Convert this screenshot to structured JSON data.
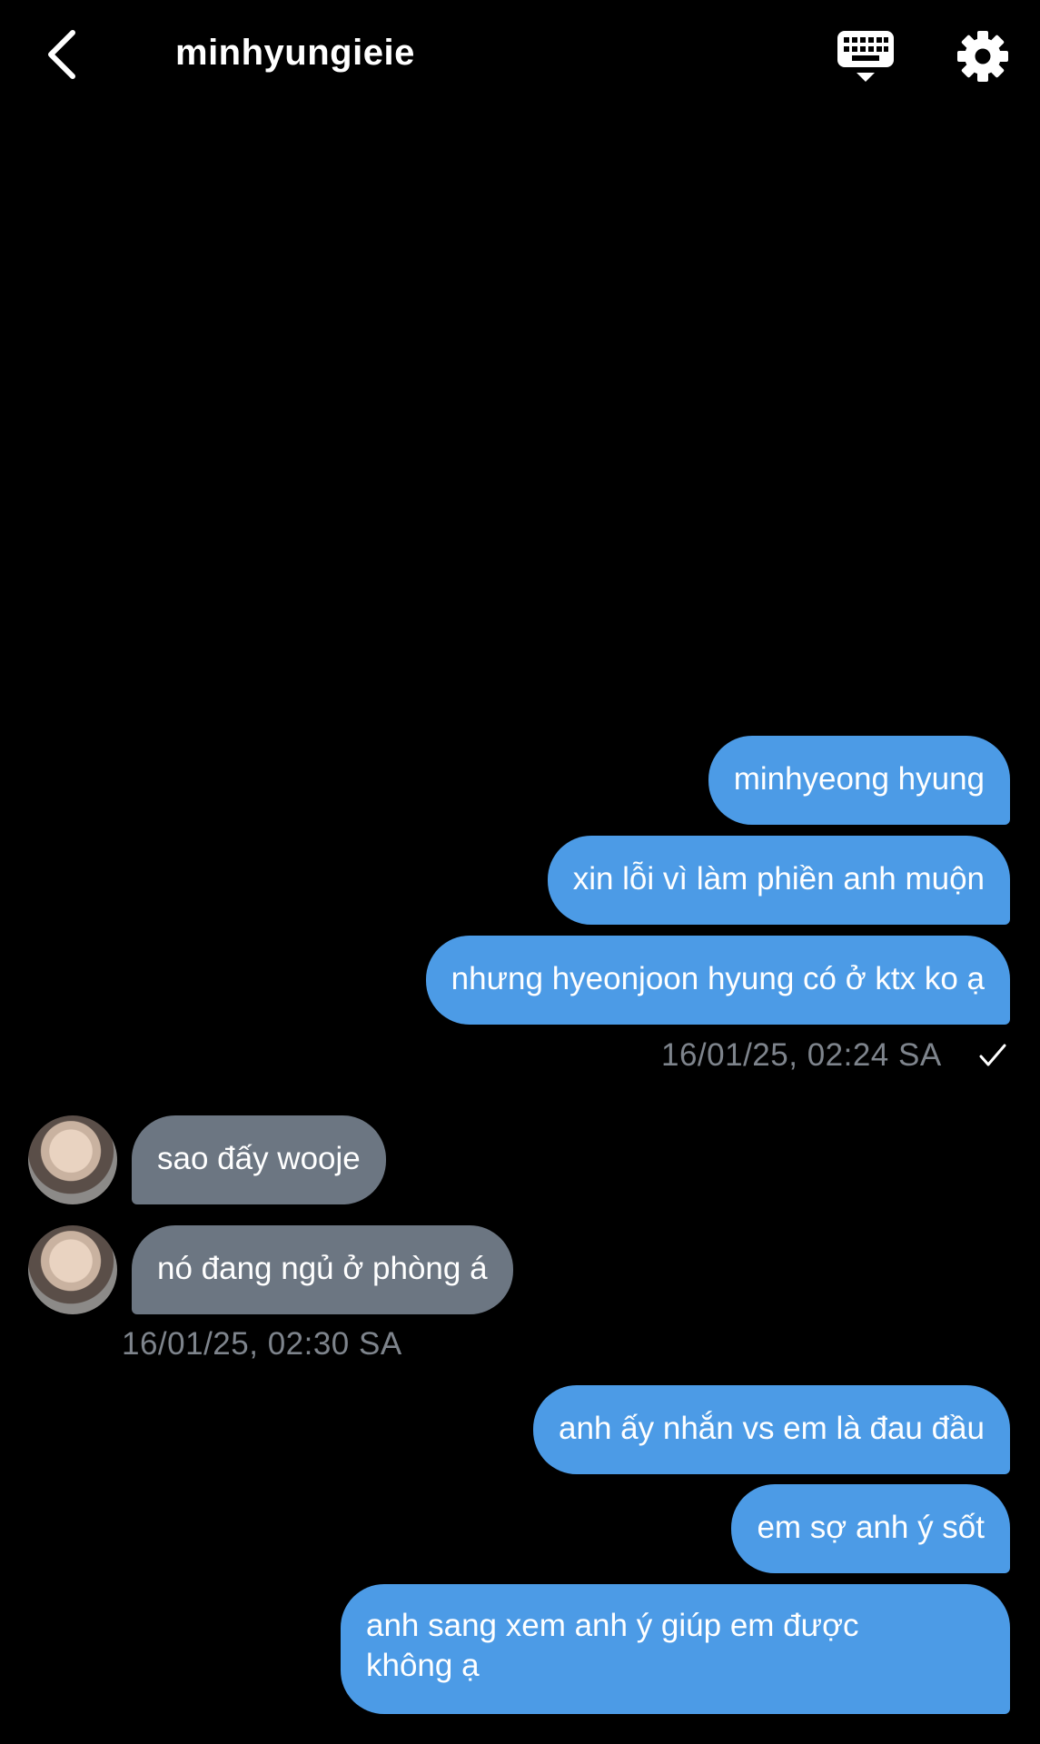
{
  "header": {
    "title": "minhyungieie"
  },
  "messages": {
    "group1": [
      "minhyeong hyung",
      "xin lỗi vì làm phiền anh muộn",
      "nhưng hyeonjoon hyung có ở ktx ko ạ"
    ],
    "group1_time": "16/01/25, 02:24 SA",
    "group2": [
      "sao đấy wooje",
      "nó đang ngủ ở phòng á"
    ],
    "group2_time": "16/01/25, 02:30 SA",
    "group3": [
      "anh ấy nhắn vs em là đau đầu",
      "em sợ anh ý sốt",
      "anh sang xem anh ý giúp em được",
      "không ạ"
    ]
  },
  "colors": {
    "background": "#000000",
    "outgoing_bubble": "#4c9be6",
    "incoming_bubble": "#6c7682",
    "timestamp": "#7e848c"
  },
  "icons": [
    "back-chevron-icon",
    "keyboard-icon",
    "gear-icon",
    "checkmark-icon"
  ]
}
